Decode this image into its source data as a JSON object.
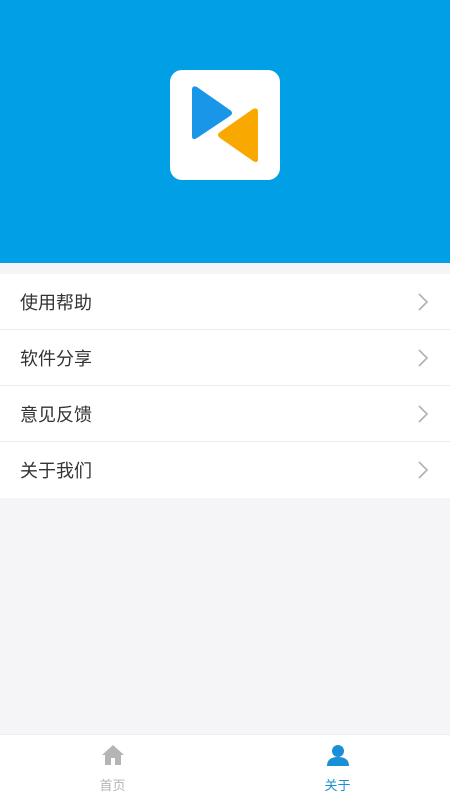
{
  "colors": {
    "header_bg": "#009fe6",
    "logo_blue": "#1a96e8",
    "logo_orange": "#f9a800",
    "tab_active": "#1a8fd6",
    "tab_inactive": "#b5b5b5"
  },
  "header": {
    "logo_icon": "play-pause-logo-icon"
  },
  "menu": {
    "items": [
      {
        "label": "使用帮助",
        "icon": "chevron-right-icon"
      },
      {
        "label": "软件分享",
        "icon": "chevron-right-icon"
      },
      {
        "label": "意见反馈",
        "icon": "chevron-right-icon"
      },
      {
        "label": "关于我们",
        "icon": "chevron-right-icon"
      }
    ]
  },
  "tabbar": {
    "tabs": [
      {
        "label": "首页",
        "icon": "home-icon",
        "active": false
      },
      {
        "label": "关于",
        "icon": "user-icon",
        "active": true
      }
    ]
  }
}
